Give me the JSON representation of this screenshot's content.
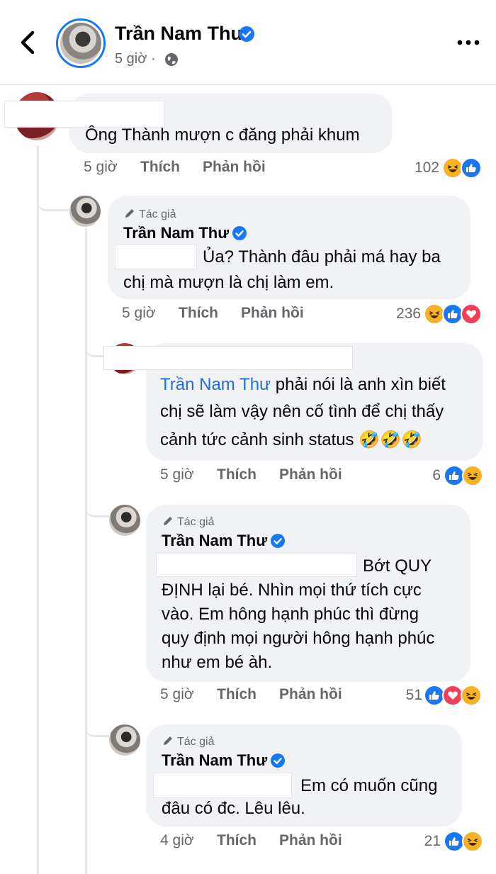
{
  "header": {
    "name": "Trần Nam Thư",
    "time": "5 giờ",
    "separator": "·",
    "icons": [
      "back-chevron-icon",
      "verified-badge-icon",
      "globe-icon",
      "more-icon"
    ]
  },
  "labels": {
    "like": "Thích",
    "reply": "Phản hồi",
    "author_tag": "Tác giả"
  },
  "comments": [
    {
      "name": "",
      "lines": [
        "Ông Thành mượn c đăng phải khum"
      ],
      "time": "5 giờ",
      "count": "102",
      "reactions": [
        "haha",
        "like"
      ]
    },
    {
      "name": "Trần Nam Thư",
      "is_author": true,
      "lines": [
        "Ủa? Thành đâu phải má hay ba",
        "chị mà mượn là chị làm em."
      ],
      "time": "5 giờ",
      "count": "236",
      "reactions": [
        "haha",
        "like",
        "love"
      ]
    },
    {
      "name": "",
      "mention": "Trần Nam Thư",
      "lines": [
        " phải nói là anh xìn biết",
        "chị sẽ làm vậy nên cố tình để chị thấy",
        "cảnh tức cảnh sinh status 🤣🤣🤣"
      ],
      "time": "5 giờ",
      "count": "6",
      "reactions": [
        "like",
        "haha"
      ]
    },
    {
      "name": "Trần Nam Thư",
      "is_author": true,
      "lines": [
        "Bớt QUY",
        "ĐỊNH lại bé. Nhìn mọi thứ tích cực",
        "vào. Em hông hạnh phúc thì đừng",
        "quy định mọi người hông hạnh phúc",
        "như em bé àh."
      ],
      "time": "5 giờ",
      "count": "51",
      "reactions": [
        "like",
        "love",
        "haha"
      ]
    },
    {
      "name": "Trần Nam Thư",
      "is_author": true,
      "lines": [
        "Em có muốn cũng",
        "đâu có đc. Lêu lêu."
      ],
      "time": "4 giờ",
      "count": "21",
      "reactions": [
        "like",
        "haha"
      ]
    }
  ]
}
